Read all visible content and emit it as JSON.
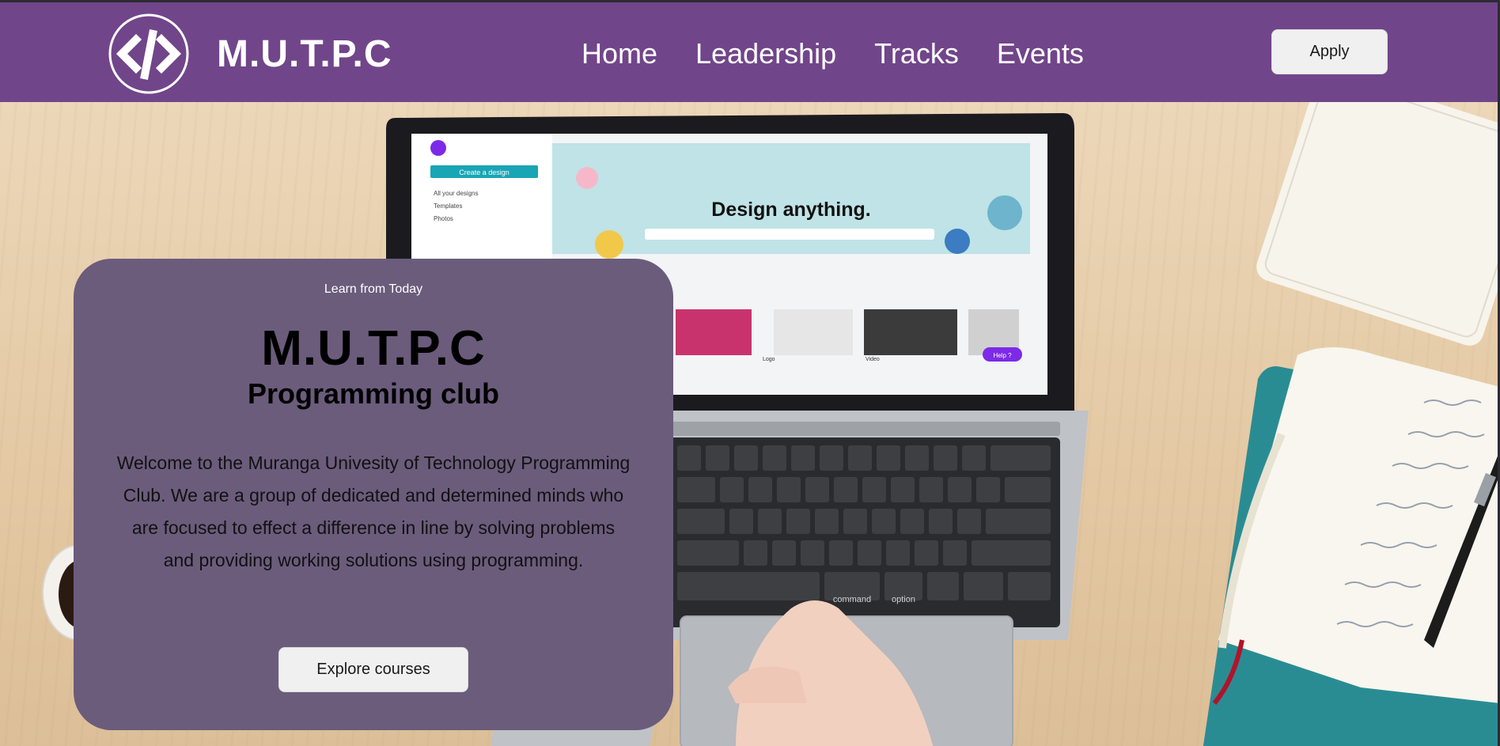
{
  "navbar": {
    "brand": "M.U.T.P.C",
    "logo_icon": "code-brackets-icon",
    "links": [
      {
        "label": "Home"
      },
      {
        "label": "Leadership"
      },
      {
        "label": "Tracks"
      },
      {
        "label": "Events"
      }
    ],
    "apply_label": "Apply"
  },
  "hero": {
    "eyebrow": "Learn from Today",
    "title": "M.U.T.P.C",
    "subtitle": "Programming club",
    "description": "Welcome to the Muranga Univesity of Technology Programming Club. We are a group of dedicated and determined minds who are focused to effect a difference in line by solving problems and providing working solutions using programming.",
    "cta_label": "Explore courses"
  },
  "screen_content": {
    "headline": "Design anything.",
    "create_button": "Create a design",
    "menu_items": [
      "All your designs",
      "Templates",
      "Photos"
    ],
    "tiles": [
      "Logo",
      "Video"
    ],
    "help_label": "Help ?",
    "keys": [
      "command",
      "option"
    ]
  },
  "colors": {
    "navbar": "#71458a",
    "card": "#6b5c7c",
    "button_bg": "#f0f0f0"
  }
}
